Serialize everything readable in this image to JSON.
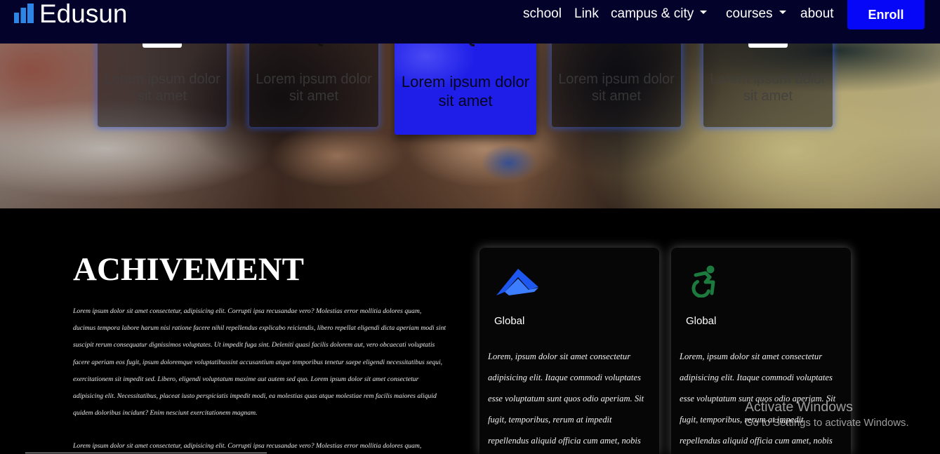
{
  "navbar": {
    "brand": "Edusun",
    "brand_icon": "bar-chart-icon",
    "links": [
      {
        "label": "school",
        "dropdown": false
      },
      {
        "label": "Link",
        "dropdown": false
      },
      {
        "label": "campus & city",
        "dropdown": true
      },
      {
        "label": "courses",
        "dropdown": true
      },
      {
        "label": "about",
        "dropdown": false
      }
    ],
    "cta_label": "Enroll"
  },
  "hero": {
    "cards": [
      {
        "text": "Lorem ipsum dolor sit amet",
        "active": false
      },
      {
        "text": "Lorem ipsum dolor sit amet",
        "active": false
      },
      {
        "text": "Lorem ipsum dolor sit amet",
        "active": true
      },
      {
        "text": "Lorem ipsum dolor sit amet",
        "active": false
      },
      {
        "text": "Lorem ipsum dolor sit amet",
        "active": false
      }
    ]
  },
  "achievement": {
    "title": "ACHIVEMENT",
    "paragraphs": [
      {
        "lines": [
          "Lorem ipsum dolor sit amet consectetur, adipisicing elit. Corrupti ipsa recusandae vero? Molestias error mollitia dolores quam,",
          "ducimus tempora labore harum nisi ratione facere nihil repellendus explicabo reiciendis, libero repellat eligendi dicta aperiam modi sint",
          "suscipit rerum consequatur dignissimos voluptates. Ut impedit fuga sint. Deleniti quasi facilis dolorem aut, vero obcaecati voluptatis",
          "facere aperiam eos fugit, ipsum doloremque voluptatibussint accusantium atque temporibus tenetur saepe eligendi necessitatibus sequi,",
          "exercitationem sit impedit sed. Libero, eligendi voluptatum maxime aut autem sed quo. Lorem ipsum dolor sit amet consectetur",
          "adipisicing elit. Necessitatibus, placeat iusto perspiciatis impedit modi, ea molestias quas atque molestiae rem facilis maiores aliquid",
          "quidem doloribus incidunt? Enim nesciunt exercitationem magnam."
        ]
      },
      {
        "lines": [
          "Lorem ipsum dolor sit amet consectetur, adipisicing elit. Corrupti ipsa recusandae vero? Molestias error mollitia dolores quam,"
        ]
      }
    ]
  },
  "feature_cards": [
    {
      "icon": "triangle-logo-icon",
      "label": "Global",
      "lines": [
        "Lorem, ipsum dolor sit amet consectetur",
        "adipisicing elit. Itaque commodi voluptates",
        "esse voluptatum sunt quos odio aperiam. Sit",
        "fugit, temporibus, rerum at impedit",
        "repellendus aliquid officia cum amet, nobis"
      ]
    },
    {
      "icon": "wheelchair-icon",
      "label": "Global",
      "lines": [
        "Lorem, ipsum dolor sit amet consectetur",
        "adipisicing elit. Itaque commodi voluptates",
        "esse voluptatum sunt quos odio aperiam. Sit",
        "fugit, temporibus, rerum at impedit",
        "repellendus aliquid officia cum amet, nobis"
      ]
    }
  ],
  "watermark": {
    "title": "Activate Windows",
    "subtitle": "Go to Settings to activate Windows."
  },
  "colors": {
    "navbar_bg": "#02022b",
    "accent": "#0707f7",
    "brand_icon": "#2d86e6",
    "active_card": "#1e1ee8",
    "card_glow": "#2a5cff",
    "icon_blue": "#1e56f0",
    "icon_blue_light": "#3d7dff",
    "icon_green": "#1d7a3e",
    "section_bg": "#000000"
  }
}
